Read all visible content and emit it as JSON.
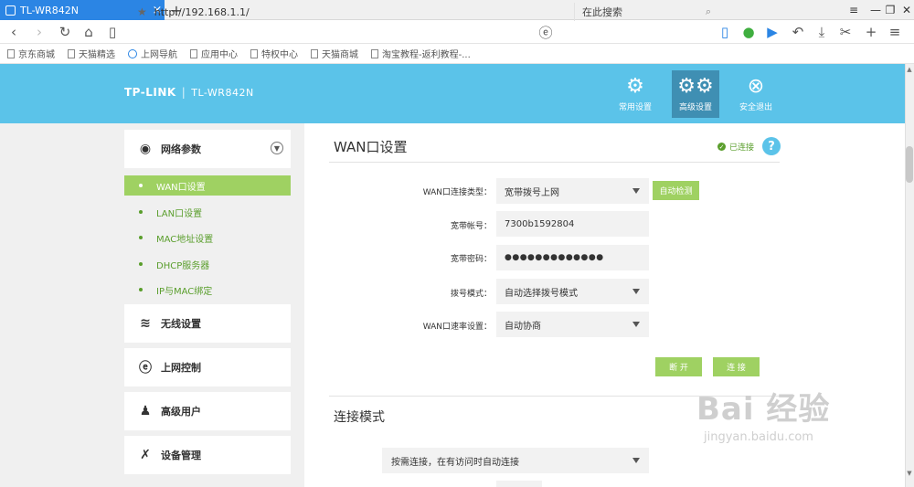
{
  "browser": {
    "tab_title": "TL-WR842N",
    "url": "http://192.168.1.1/",
    "search_placeholder": "在此搜索",
    "bookmarks": [
      {
        "label": "京东商城",
        "icon": "doc"
      },
      {
        "label": "天猫精选",
        "icon": "doc"
      },
      {
        "label": "上网导航",
        "icon": "ie"
      },
      {
        "label": "应用中心",
        "icon": "doc"
      },
      {
        "label": "特权中心",
        "icon": "doc"
      },
      {
        "label": "天猫商城",
        "icon": "doc"
      },
      {
        "label": "淘宝教程-返利教程-...",
        "icon": "doc"
      }
    ]
  },
  "header": {
    "brand": "TP-LINK",
    "model": "TL-WR842N",
    "buttons": {
      "basic": "常用设置",
      "advanced": "高级设置",
      "logout": "安全退出"
    }
  },
  "sidebar": {
    "network": {
      "label": "网络参数",
      "items": [
        "WAN口设置",
        "LAN口设置",
        "MAC地址设置",
        "DHCP服务器",
        "IP与MAC绑定"
      ]
    },
    "wireless": "无线设置",
    "internet_control": "上网控制",
    "advanced_user": "高级用户",
    "device_management": "设备管理"
  },
  "wan": {
    "title": "WAN口设置",
    "status": "已连接",
    "help": "?",
    "fields": {
      "conn_type": {
        "label": "WAN口连接类型：",
        "value": "宽带拨号上网"
      },
      "account": {
        "label": "宽带帐号：",
        "value": "7300b1592804"
      },
      "password": {
        "label": "宽带密码：",
        "value": "●●●●●●●●●●●●●"
      },
      "dial_mode": {
        "label": "拨号模式：",
        "value": "自动选择拨号模式"
      },
      "speed": {
        "label": "WAN口速率设置：",
        "value": "自动协商"
      }
    },
    "auto_detect": "自动检测",
    "disconnect": "断 开",
    "connect": "连 接"
  },
  "connection_mode": {
    "title": "连接模式",
    "value": "按需连接，在有访问时自动连接"
  },
  "watermark": {
    "line1": "Bai 经验",
    "line2": "jingyan.baidu.com"
  },
  "colors": {
    "header_bg": "#5bc3e9",
    "active_nav": "#3f8fb3",
    "accent_green": "#9fd162",
    "text_green": "#5a9e2c",
    "tab_blue": "#2b85e4"
  }
}
